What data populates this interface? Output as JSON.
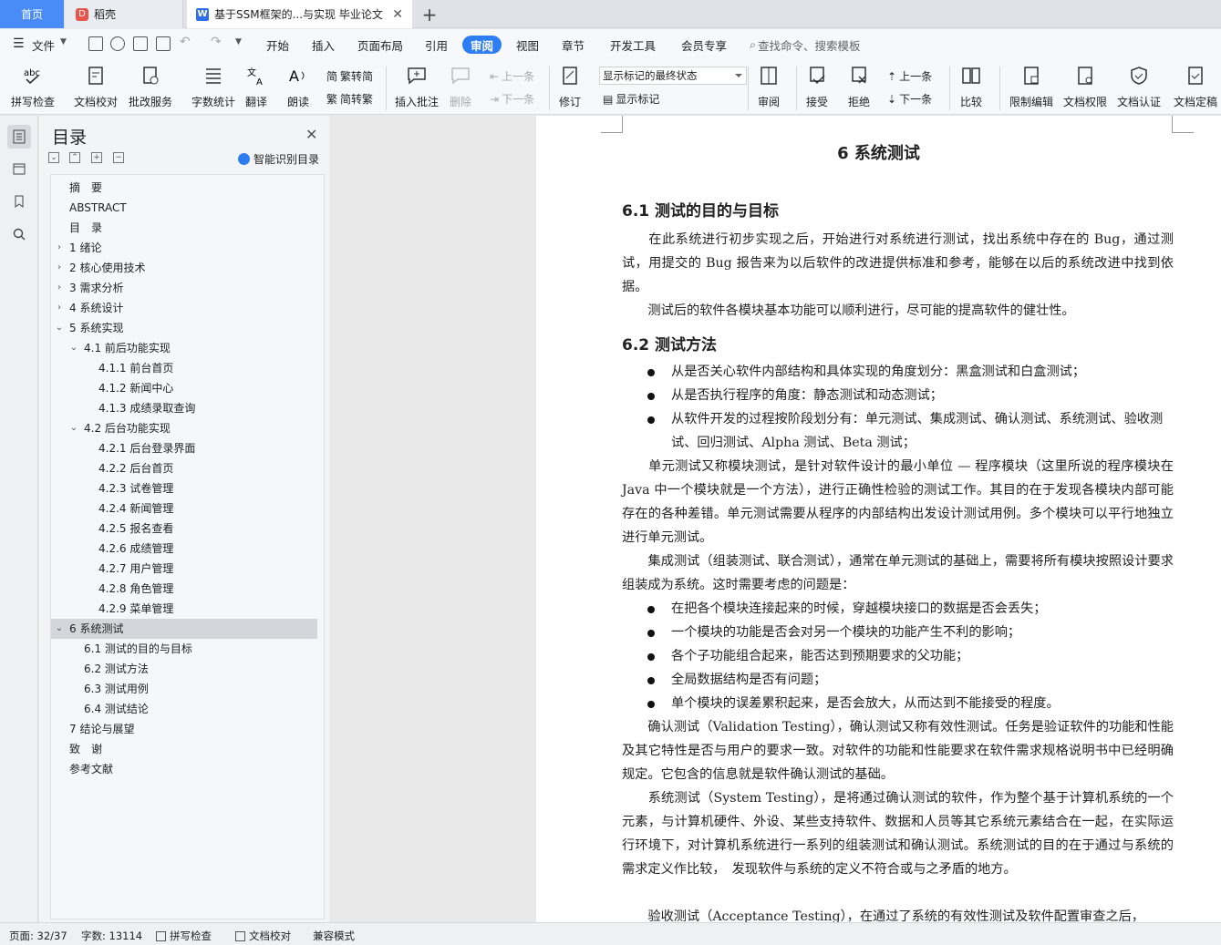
{
  "tabs": {
    "home": "首页",
    "wps": "稻壳",
    "doc": "基于SSM框架的...与实现 毕业论文"
  },
  "menubar": {
    "file": "文件",
    "items": [
      "开始",
      "插入",
      "页面布局",
      "引用",
      "审阅",
      "视图",
      "章节",
      "开发工具",
      "会员专享"
    ],
    "active": "审阅",
    "search": "查找命令、搜索模板"
  },
  "ribbon": {
    "spell": "拼写检查",
    "proof": "文档校对",
    "batch": "批改服务",
    "wordcount": "字数统计",
    "translate": "翻译",
    "read": "朗读",
    "trad": "繁转简",
    "simp": "简转繁",
    "insert_comment": "插入批注",
    "delete": "删除",
    "prev_comment": "上一条",
    "next_comment": "下一条",
    "revise": "修订",
    "markup_select": "显示标记的最终状态",
    "show_markup": "显示标记",
    "review": "审阅",
    "accept": "接受",
    "reject": "拒绝",
    "prev": "上一条",
    "next": "下一条",
    "compare": "比较",
    "restrict": "限制编辑",
    "permission": "文档权限",
    "certify": "文档认证",
    "finalize": "文档定稿"
  },
  "toc": {
    "title": "目录",
    "smart": "智能识别目录",
    "items": [
      {
        "label": "摘　要",
        "level": 0,
        "arrow": ""
      },
      {
        "label": "ABSTRACT",
        "level": 0,
        "arrow": ""
      },
      {
        "label": "目　录",
        "level": 0,
        "arrow": ""
      },
      {
        "label": "1  绪论",
        "level": 0,
        "arrow": ">"
      },
      {
        "label": "2  核心使用技术",
        "level": 0,
        "arrow": ">"
      },
      {
        "label": "3  需求分析",
        "level": 0,
        "arrow": ">"
      },
      {
        "label": "4  系统设计",
        "level": 0,
        "arrow": ">"
      },
      {
        "label": "5  系统实现",
        "level": 0,
        "arrow": "v"
      },
      {
        "label": "4.1  前后功能实现",
        "level": 1,
        "arrow": "v"
      },
      {
        "label": "4.1.1  前台首页",
        "level": 2,
        "arrow": ""
      },
      {
        "label": "4.1.2  新闻中心",
        "level": 2,
        "arrow": ""
      },
      {
        "label": "4.1.3  成绩录取查询",
        "level": 2,
        "arrow": ""
      },
      {
        "label": "4.2  后台功能实现",
        "level": 1,
        "arrow": "v"
      },
      {
        "label": "4.2.1  后台登录界面",
        "level": 2,
        "arrow": ""
      },
      {
        "label": "4.2.2  后台首页",
        "level": 2,
        "arrow": ""
      },
      {
        "label": "4.2.3  试卷管理",
        "level": 2,
        "arrow": ""
      },
      {
        "label": "4.2.4  新闻管理",
        "level": 2,
        "arrow": ""
      },
      {
        "label": "4.2.5  报名查看",
        "level": 2,
        "arrow": ""
      },
      {
        "label": "4.2.6  成绩管理",
        "level": 2,
        "arrow": ""
      },
      {
        "label": "4.2.7  用户管理",
        "level": 2,
        "arrow": ""
      },
      {
        "label": "4.2.8  角色管理",
        "level": 2,
        "arrow": ""
      },
      {
        "label": "4.2.9  菜单管理",
        "level": 2,
        "arrow": ""
      },
      {
        "label": "6  系统测试",
        "level": 0,
        "arrow": "v",
        "selected": true
      },
      {
        "label": "6.1  测试的目的与目标",
        "level": 1,
        "arrow": ""
      },
      {
        "label": "6.2  测试方法",
        "level": 1,
        "arrow": ""
      },
      {
        "label": "6.3  测试用例",
        "level": 1,
        "arrow": ""
      },
      {
        "label": "6.4  测试结论",
        "level": 1,
        "arrow": ""
      },
      {
        "label": "7  结论与展望",
        "level": 0,
        "arrow": ""
      },
      {
        "label": "致　谢",
        "level": 0,
        "arrow": ""
      },
      {
        "label": "参考文献",
        "level": 0,
        "arrow": ""
      }
    ]
  },
  "doc": {
    "chapter": "6  系统测试",
    "s61": "6.1  测试的目的与目标",
    "p1": "　　在此系统进行初步实现之后，开始进行对系统进行测试，找出系统中存在的 Bug，通过测试，用提交的 Bug 报告来为以后软件的改进提供标准和参考，能够在以后的系统改进中找到依据。",
    "p2": "　　测试后的软件各模块基本功能可以顺利进行，尽可能的提高软件的健壮性。",
    "s62": "6.2  测试方法",
    "b1": "从是否关心软件内部结构和具体实现的角度划分：黑盒测试和白盒测试；",
    "b2": "从是否执行程序的角度：静态测试和动态测试；",
    "b3": "从软件开发的过程按阶段划分有：单元测试、集成测试、确认测试、系统测试、验收测试、回归测试、Alpha 测试、Beta 测试；",
    "p3": "　　单元测试又称模块测试，是针对软件设计的最小单位 — 程序模块（这里所说的程序模块在 Java 中一个模块就是一个方法），进行正确性检验的测试工作。其目的在于发现各模块内部可能存在的各种差错。单元测试需要从程序的内部结构出发设计测试用例。多个模块可以平行地独立进行单元测试。",
    "p4": "　　集成测试（组装测试、联合测试），通常在单元测试的基础上，需要将所有模块按照设计要求组装成为系统。这时需要考虑的问题是：",
    "b4": "在把各个模块连接起来的时候，穿越模块接口的数据是否会丢失；",
    "b5": "一个模块的功能是否会对另一个模块的功能产生不利的影响；",
    "b6": "各个子功能组合起来，能否达到预期要求的父功能；",
    "b7": "全局数据结构是否有问题；",
    "b8": "单个模块的误差累积起来，是否会放大，从而达到不能接受的程度。",
    "p5": "　　确认测试（Validation Testing），确认测试又称有效性测试。任务是验证软件的功能和性能及其它特性是否与用户的要求一致。对软件的功能和性能要求在软件需求规格说明书中已经明确规定。它包含的信息就是软件确认测试的基础。",
    "p6": "　　系统测试（System Testing），是将通过确认测试的软件，作为整个基于计算机系统的一个元素，与计算机硬件、外设、某些支持软件、数据和人员等其它系统元素结合在一起，在实际运行环境下，对计算机系统进行一系列的组装测试和确认测试。系统测试的目的在于通过与系统的需求定义作比较，　发现软件与系统的定义不符合或与之矛盾的地方。",
    "p7": "　　验收测试（Acceptance Testing），在通过了系统的有效性测试及软件配置审查之后，"
  },
  "status": {
    "page": "页面: 32/37",
    "words": "字数: 13114",
    "spell": "拼写检查",
    "proof": "文档校对",
    "compat": "兼容模式"
  }
}
